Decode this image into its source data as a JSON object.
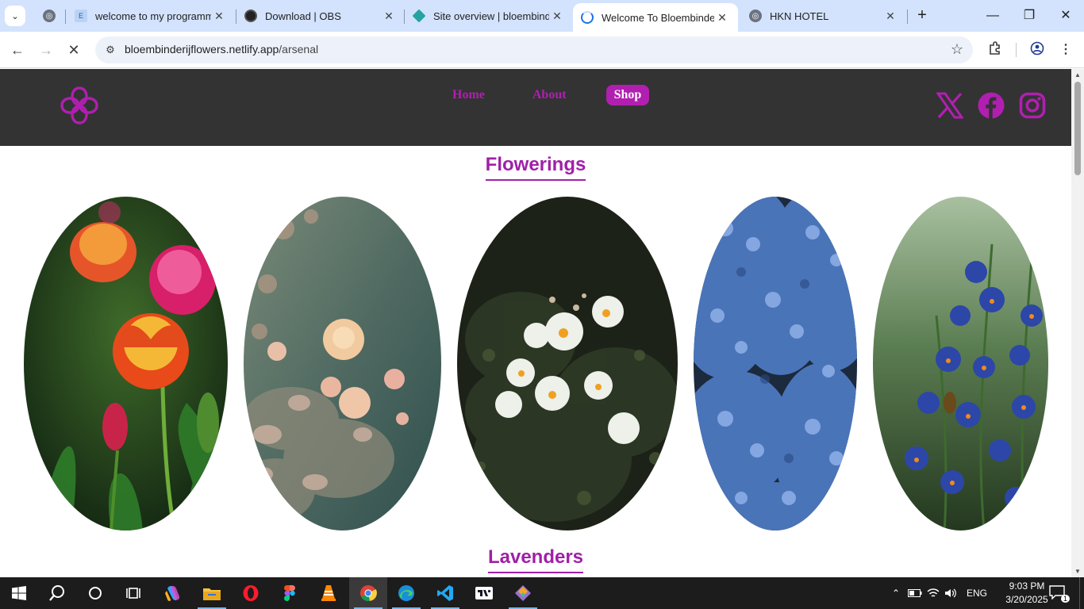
{
  "browser": {
    "tabs": [
      {
        "title": "welcome to my programm",
        "favicon": "e-site-icon",
        "active": false
      },
      {
        "title": "Download | OBS",
        "favicon": "obs-icon",
        "active": false
      },
      {
        "title": "Site overview | bloembinde",
        "favicon": "netlify-icon",
        "active": false
      },
      {
        "title": "Welcome To Bloembinderij",
        "favicon": "loading-icon",
        "active": true
      },
      {
        "title": "HKN HOTEL",
        "favicon": "globe-icon",
        "active": false
      }
    ],
    "address": {
      "host": "bloembinderijflowers.netlify.app",
      "path": "/arsenal"
    }
  },
  "site": {
    "nav": {
      "home": "Home",
      "about": "About",
      "shop": "Shop"
    },
    "sections": {
      "flowerings": "Flowerings",
      "lavenders": "Lavenders"
    },
    "brand_color": "#b01fb0",
    "header_bg": "#333333",
    "flowers": [
      {
        "name": "tulips-image"
      },
      {
        "name": "peach-roses-image"
      },
      {
        "name": "white-roses-image"
      },
      {
        "name": "blue-hydrangea-image"
      },
      {
        "name": "blue-wildflowers-image"
      }
    ]
  },
  "taskbar": {
    "apps": [
      "start-icon",
      "search-icon",
      "cortana-icon",
      "task-view-icon",
      "copilot-icon",
      "file-explorer-icon",
      "opera-icon",
      "figma-icon",
      "vlc-icon",
      "chrome-icon",
      "edge-icon",
      "vscode-icon",
      "tradingview-icon",
      "git-icon"
    ],
    "language": "ENG",
    "time": "9:03 PM",
    "date": "3/20/2025",
    "notification_count": "1"
  }
}
